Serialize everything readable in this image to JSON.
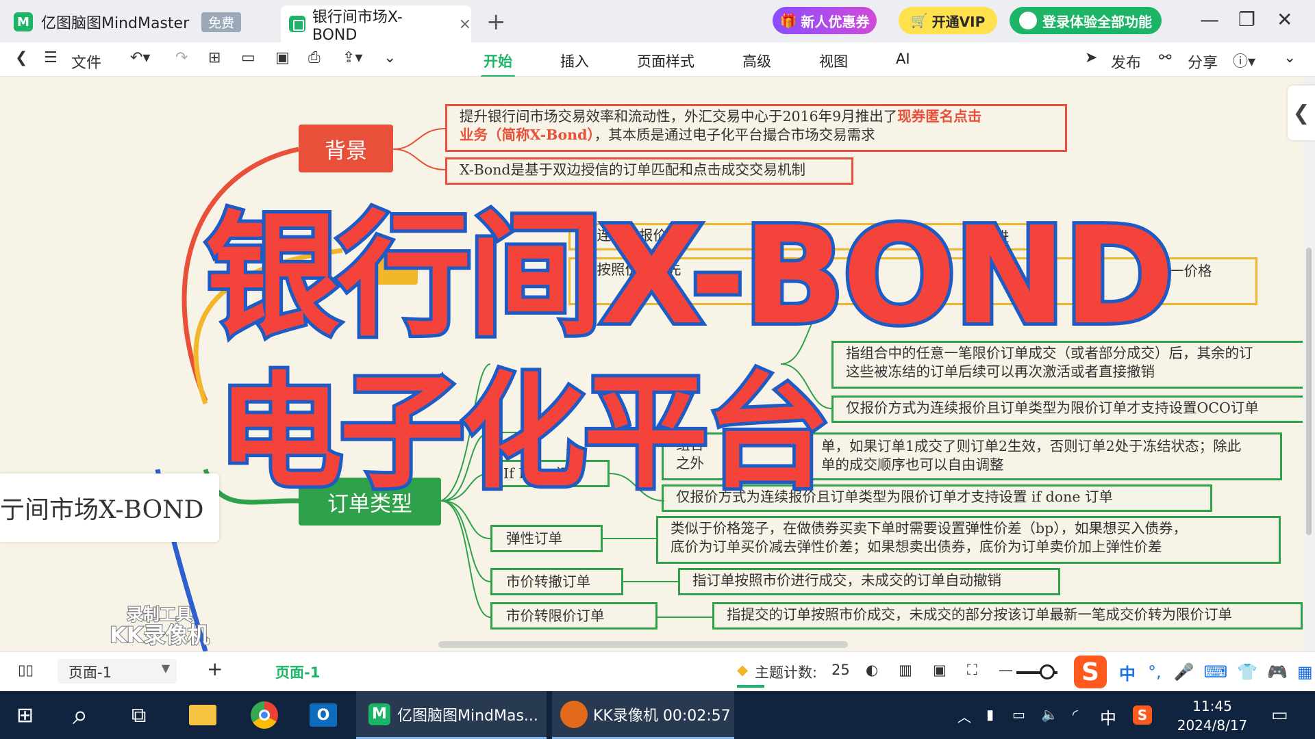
{
  "titlebar": {
    "app_tab": "亿图脑图MindMaster",
    "free_badge": "免费",
    "doc_tab": "银行间市场X-BOND",
    "promo": "新人优惠券",
    "vip": "开通VIP",
    "login": "登录体验全部功能"
  },
  "toolbar": {
    "file": "文件",
    "menus": [
      "开始",
      "插入",
      "页面样式",
      "高级",
      "视图",
      "AI"
    ],
    "publish": "发布",
    "share": "分享"
  },
  "mindmap": {
    "main": "亍间市场X-BOND",
    "branches": {
      "background": "背景",
      "order_types": "订单类型"
    },
    "background_notes": {
      "note1_plain": "提升银行间市场交易效率和流动性，外汇交易中心于2016年9月推出了",
      "note1_emph_a": "现券匿名点击",
      "note1_emph_b": "业务（简称X-Bond）",
      "note1_tail": "，其本质是通过电子化平台撮合市场交易需求",
      "note2": "X-Bond是基于双边授信的订单匹配和点击成交交易机制"
    },
    "partial": {
      "yellow1": "指连续将报价按",
      "yellow1b": "优先",
      "yellow1c": "进",
      "yellow2": "指按照价格优先",
      "yellow2_tail": "定统一价格",
      "yellow2b": "交",
      "green_a": "组合",
      "green_a_tail": "单，如果订单1成交了则订单2生效，否则订单2处于冻结状态；除此",
      "green_b": "之外",
      "green_b_tail": "单的成交顺序也可以自由调整"
    },
    "oco_notes": {
      "n1_line1": "指组合中的任意一笔限价订单成交（或者部分成交）后，其余的订",
      "n1_line2": "这些被冻结的订单后续可以再次激活或者直接撤销",
      "n2": "仅报价方式为连续报价且订单类型为限价订单才支持设置OCO订单"
    },
    "order_types": [
      {
        "name": "If Done订单",
        "desc": "仅报价方式为连续报价且订单类型为限价订单才支持设置 if done 订单"
      },
      {
        "name": "弹性订单",
        "desc_line1": "类似于价格笼子，在做债券买卖下单时需要设置弹性价差（bp），如果想买入债券，",
        "desc_line2": "底价为订单买价减去弹性价差；如果想卖出债券，底价为订单卖价加上弹性价差"
      },
      {
        "name": "市价转撤订单",
        "desc": "指订单按照市价进行成交，未成交的订单自动撤销"
      },
      {
        "name": "市价转限价订单",
        "desc": "指提交的订单按照市价成交，未成交的部分按该订单最新一笔成交价转为限价订单"
      }
    ]
  },
  "overlay": {
    "line1": "银行间X-BOND",
    "line2": "电子化平台"
  },
  "watermark": {
    "line1": "录制工具",
    "line2": "KK录像机"
  },
  "statusbar": {
    "page_select": "页面-1",
    "page_tab": "页面-1",
    "topic_label": "主题计数:",
    "topic_count": "25",
    "ime_lang": "中"
  },
  "taskbar": {
    "app1": "亿图脑图MindMas...",
    "app2": "KK录像机 00:02:57",
    "tray_lang": "中",
    "time": "11:45",
    "date": "2024/8/17"
  },
  "colors": {
    "red": "#e8503a",
    "yellow": "#f2b62a",
    "green": "#2ea14a",
    "blue": "#2d5fd1",
    "brand": "#1cb567"
  }
}
